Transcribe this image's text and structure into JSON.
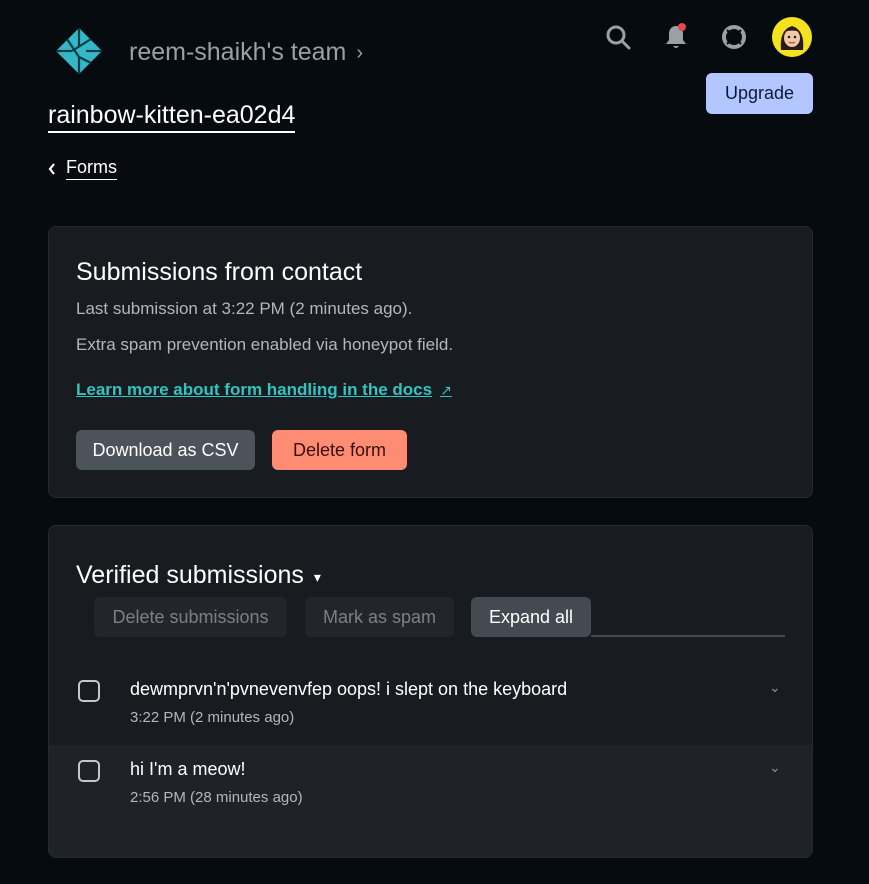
{
  "header": {
    "team_name": "reem-shaikh's team",
    "site_name": "rainbow-kitten-ea02d4",
    "upgrade_label": "Upgrade",
    "icons": [
      "search-icon",
      "bell-icon",
      "help-icon",
      "avatar"
    ],
    "notification_dot_color": "#e5484d"
  },
  "breadcrumb": {
    "back_label": "Forms"
  },
  "form_card": {
    "title": "Submissions from contact",
    "last_submission": "Last submission at 3:22 PM (2 minutes ago).",
    "spam_note": "Extra spam prevention enabled via honeypot field.",
    "docs_link": "Learn more about form handling in the docs",
    "csv_label": "Download as CSV",
    "delete_form_label": "Delete form"
  },
  "submissions": {
    "title": "Verified submissions",
    "delete_label": "Delete submissions",
    "spam_label": "Mark as spam",
    "expand_label": "Expand all",
    "items": [
      {
        "text": "dewmprvn'n'pvnevenvfep oops! i slept on the keyboard",
        "time": "3:22 PM (2 minutes ago)"
      },
      {
        "text": "hi I'm a meow!",
        "time": "2:56 PM (28 minutes ago)"
      }
    ]
  },
  "colors": {
    "background": "#060b10",
    "card": "#181b20",
    "accent_link": "#32c4c0",
    "upgrade": "#b3c6ff",
    "danger": "#fd8c73"
  }
}
